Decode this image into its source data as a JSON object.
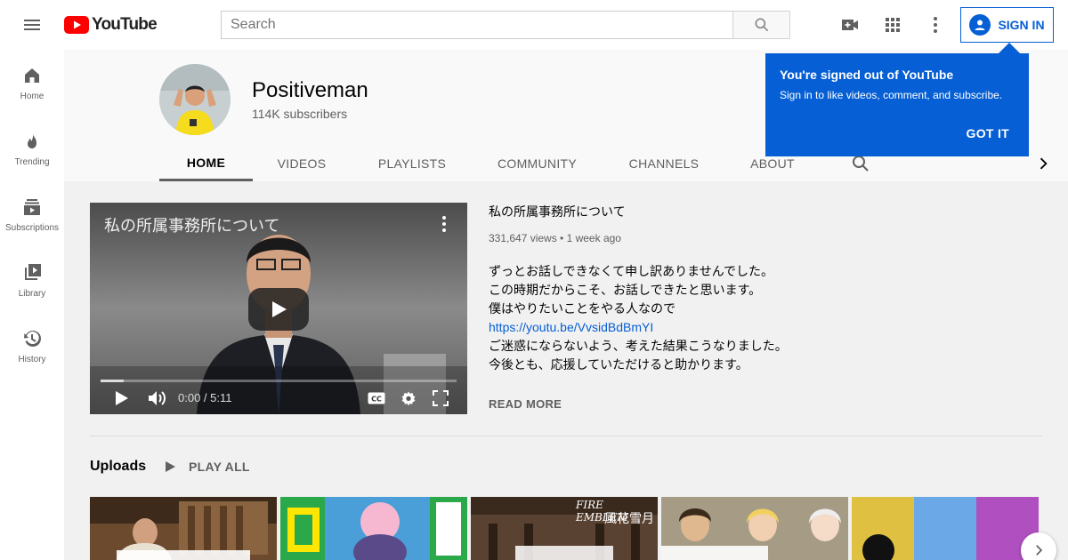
{
  "header": {
    "logo_text": "YouTube",
    "search_placeholder": "Search",
    "sign_in_label": "SIGN IN",
    "brand_color": "#ff0000",
    "accent_color": "#065fd4"
  },
  "sidebar": {
    "items": [
      {
        "label": "Home",
        "icon": "home-icon"
      },
      {
        "label": "Trending",
        "icon": "trending-icon"
      },
      {
        "label": "Subscriptions",
        "icon": "subscriptions-icon"
      },
      {
        "label": "Library",
        "icon": "library-icon"
      },
      {
        "label": "History",
        "icon": "history-icon"
      }
    ]
  },
  "channel": {
    "name": "Positiveman",
    "subscribers": "114K subscribers",
    "tabs": [
      "HOME",
      "VIDEOS",
      "PLAYLISTS",
      "COMMUNITY",
      "CHANNELS",
      "ABOUT"
    ],
    "active_tab": "HOME"
  },
  "popup": {
    "title": "You're signed out of YouTube",
    "text": "Sign in to like videos, comment, and subscribe.",
    "button": "GOT IT"
  },
  "featured": {
    "player_title": "私の所属事務所について",
    "time": "0:00 / 5:11",
    "title": "私の所属事務所について",
    "meta": "331,647 views • 1 week ago",
    "description": [
      "ずっとお話しできなくて申し訳ありませんでした。",
      "この時期だからこそ、お話しできたと思います。",
      "僕はやりたいことをやる人なので"
    ],
    "link": "https://youtu.be/VvsidBdBmYI",
    "description_after": [
      "ご迷惑にならないよう、考えた結果こうなりました。",
      "今後とも、応援していただけると助かります。"
    ],
    "read_more": "READ MORE"
  },
  "uploads": {
    "title": "Uploads",
    "play_all": "PLAY ALL",
    "thumbnail_texts": [
      "FIRE EMBLEM",
      "風花雪月"
    ]
  }
}
